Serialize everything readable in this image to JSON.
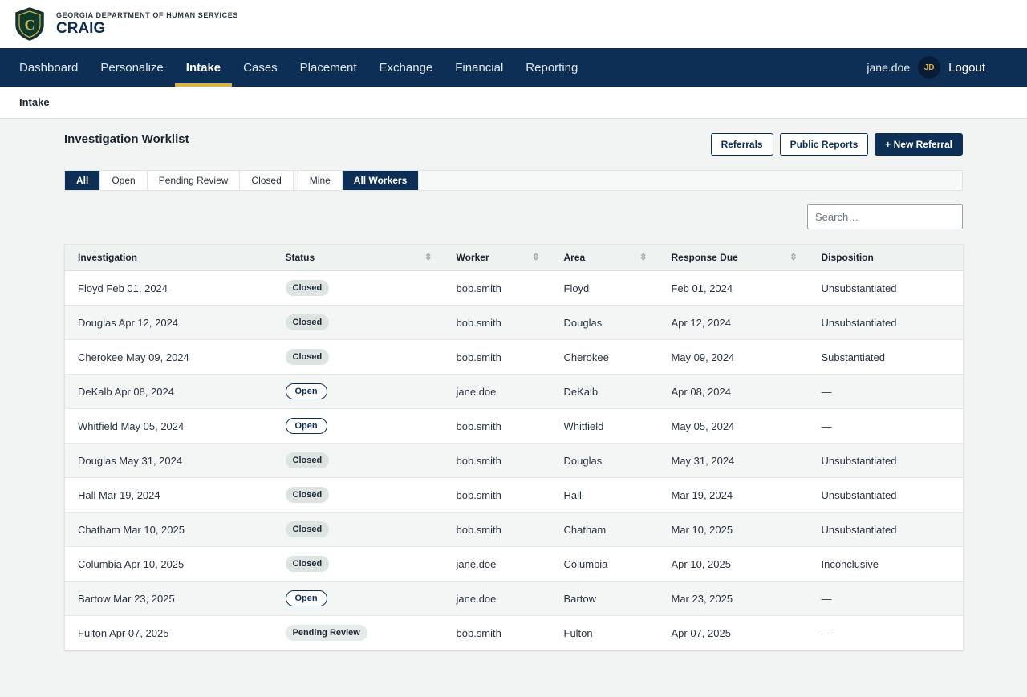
{
  "brand": {
    "department": "GEORGIA DEPARTMENT OF HUMAN SERVICES",
    "app_name": "CRAIG",
    "logo_letter": "C"
  },
  "nav": {
    "items": [
      {
        "label": "Dashboard",
        "active": false
      },
      {
        "label": "Personalize",
        "active": false
      },
      {
        "label": "Intake",
        "active": true
      },
      {
        "label": "Cases",
        "active": false
      },
      {
        "label": "Placement",
        "active": false
      },
      {
        "label": "Exchange",
        "active": false
      },
      {
        "label": "Financial",
        "active": false
      },
      {
        "label": "Reporting",
        "active": false
      }
    ],
    "username": "jane.doe",
    "avatar_initials": "JD",
    "logout_label": "Logout"
  },
  "breadcrumb": "Intake",
  "page": {
    "title": "Investigation Worklist",
    "buttons": {
      "referrals": "Referrals",
      "public_reports": "Public Reports",
      "new_referral": "+ New Referral"
    },
    "status_filters": [
      {
        "label": "All",
        "active": true
      },
      {
        "label": "Open",
        "active": false
      },
      {
        "label": "Pending Review",
        "active": false
      },
      {
        "label": "Closed",
        "active": false
      }
    ],
    "worker_filters": [
      {
        "label": "Mine",
        "active": false
      },
      {
        "label": "All Workers",
        "active": true
      }
    ],
    "search_placeholder": "Search…"
  },
  "table": {
    "columns": [
      "Investigation",
      "Status",
      "Worker",
      "Area",
      "Response Due",
      "Disposition"
    ],
    "rows": [
      {
        "investigation": "Floyd Feb 01, 2024",
        "status": "Closed",
        "worker": "bob.smith",
        "area": "Floyd",
        "due": "Feb 01, 2024",
        "disposition": "Unsubstantiated"
      },
      {
        "investigation": "Douglas Apr 12, 2024",
        "status": "Closed",
        "worker": "bob.smith",
        "area": "Douglas",
        "due": "Apr 12, 2024",
        "disposition": "Unsubstantiated"
      },
      {
        "investigation": "Cherokee May 09, 2024",
        "status": "Closed",
        "worker": "bob.smith",
        "area": "Cherokee",
        "due": "May 09, 2024",
        "disposition": "Substantiated"
      },
      {
        "investigation": "DeKalb Apr 08, 2024",
        "status": "Open",
        "worker": "jane.doe",
        "area": "DeKalb",
        "due": "Apr 08, 2024",
        "disposition": "—"
      },
      {
        "investigation": "Whitfield May 05, 2024",
        "status": "Open",
        "worker": "bob.smith",
        "area": "Whitfield",
        "due": "May 05, 2024",
        "disposition": "—"
      },
      {
        "investigation": "Douglas May 31, 2024",
        "status": "Closed",
        "worker": "bob.smith",
        "area": "Douglas",
        "due": "May 31, 2024",
        "disposition": "Unsubstantiated"
      },
      {
        "investigation": "Hall Mar 19, 2024",
        "status": "Closed",
        "worker": "bob.smith",
        "area": "Hall",
        "due": "Mar 19, 2024",
        "disposition": "Unsubstantiated"
      },
      {
        "investigation": "Chatham Mar 10, 2025",
        "status": "Closed",
        "worker": "bob.smith",
        "area": "Chatham",
        "due": "Mar 10, 2025",
        "disposition": "Unsubstantiated"
      },
      {
        "investigation": "Columbia Apr 10, 2025",
        "status": "Closed",
        "worker": "jane.doe",
        "area": "Columbia",
        "due": "Apr 10, 2025",
        "disposition": "Inconclusive"
      },
      {
        "investigation": "Bartow Mar 23, 2025",
        "status": "Open",
        "worker": "jane.doe",
        "area": "Bartow",
        "due": "Mar 23, 2025",
        "disposition": "—"
      },
      {
        "investigation": "Fulton Apr 07, 2025",
        "status": "Pending Review",
        "worker": "bob.smith",
        "area": "Fulton",
        "due": "Apr 07, 2025",
        "disposition": "—"
      }
    ]
  },
  "colors": {
    "navy": "#0e2f55",
    "gold": "#d8b24a",
    "background": "#f1f4f3"
  }
}
